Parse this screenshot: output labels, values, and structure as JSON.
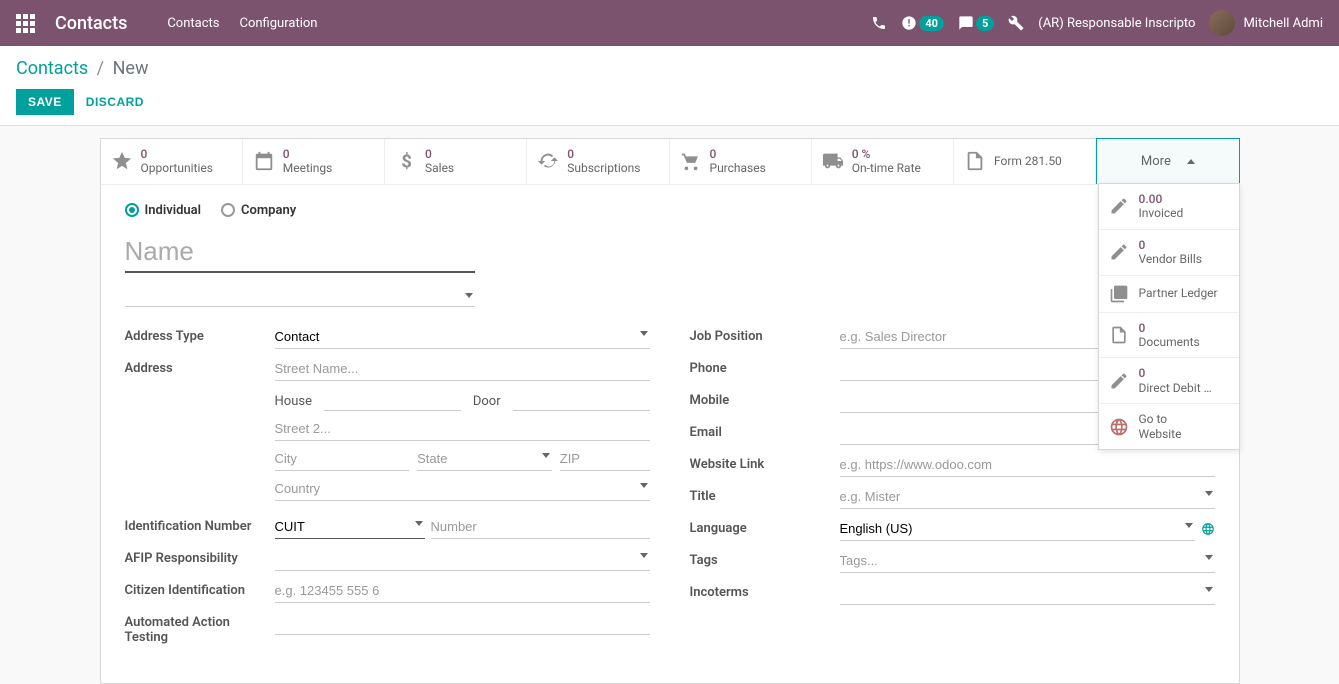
{
  "navbar": {
    "brand": "Contacts",
    "links": [
      "Contacts",
      "Configuration"
    ],
    "notifications_count": "40",
    "messages_count": "5",
    "company": "(AR) Responsable Inscripto",
    "user": "Mitchell Admi"
  },
  "breadcrumb": {
    "root": "Contacts",
    "current": "New"
  },
  "actions": {
    "save": "SAVE",
    "discard": "DISCARD"
  },
  "stats": {
    "opportunities": {
      "value": "0",
      "label": "Opportunities"
    },
    "meetings": {
      "value": "0",
      "label": "Meetings"
    },
    "sales": {
      "value": "0",
      "label": "Sales"
    },
    "subscriptions": {
      "value": "0",
      "label": "Subscriptions"
    },
    "purchases": {
      "value": "0",
      "label": "Purchases"
    },
    "ontime": {
      "value": "0 %",
      "label": "On-time Rate"
    },
    "form281": {
      "label": "Form 281.50"
    },
    "more": "More"
  },
  "more_menu": {
    "invoiced": {
      "value": "0.00",
      "label": "Invoiced"
    },
    "vendor_bills": {
      "value": "0",
      "label": "Vendor Bills"
    },
    "partner_ledger": {
      "label": "Partner Ledger"
    },
    "documents": {
      "value": "0",
      "label": "Documents"
    },
    "direct_debit": {
      "value": "0",
      "label": "Direct Debit …"
    },
    "go_website": {
      "label1": "Go to",
      "label2": "Website"
    }
  },
  "contact_type": {
    "individual": "Individual",
    "company": "Company"
  },
  "name_placeholder": "Name",
  "left": {
    "address_type_label": "Address Type",
    "address_type_value": "Contact",
    "address_label": "Address",
    "street_placeholder": "Street Name...",
    "house_label": "House",
    "door_label": "Door",
    "street2_placeholder": "Street 2...",
    "city_placeholder": "City",
    "state_placeholder": "State",
    "zip_placeholder": "ZIP",
    "country_placeholder": "Country",
    "idnum_label": "Identification Number",
    "idnum_type": "CUIT",
    "idnum_number_placeholder": "Number",
    "afip_label": "AFIP Responsibility",
    "citizen_label": "Citizen Identification",
    "citizen_placeholder": "e.g. 123455 555 6",
    "automated_label": "Automated Action Testing"
  },
  "right": {
    "job_label": "Job Position",
    "job_placeholder": "e.g. Sales Director",
    "phone_label": "Phone",
    "mobile_label": "Mobile",
    "email_label": "Email",
    "website_label": "Website Link",
    "website_placeholder": "e.g. https://www.odoo.com",
    "title_label": "Title",
    "title_placeholder": "e.g. Mister",
    "language_label": "Language",
    "language_value": "English (US)",
    "tags_label": "Tags",
    "tags_placeholder": "Tags...",
    "incoterms_label": "Incoterms"
  }
}
